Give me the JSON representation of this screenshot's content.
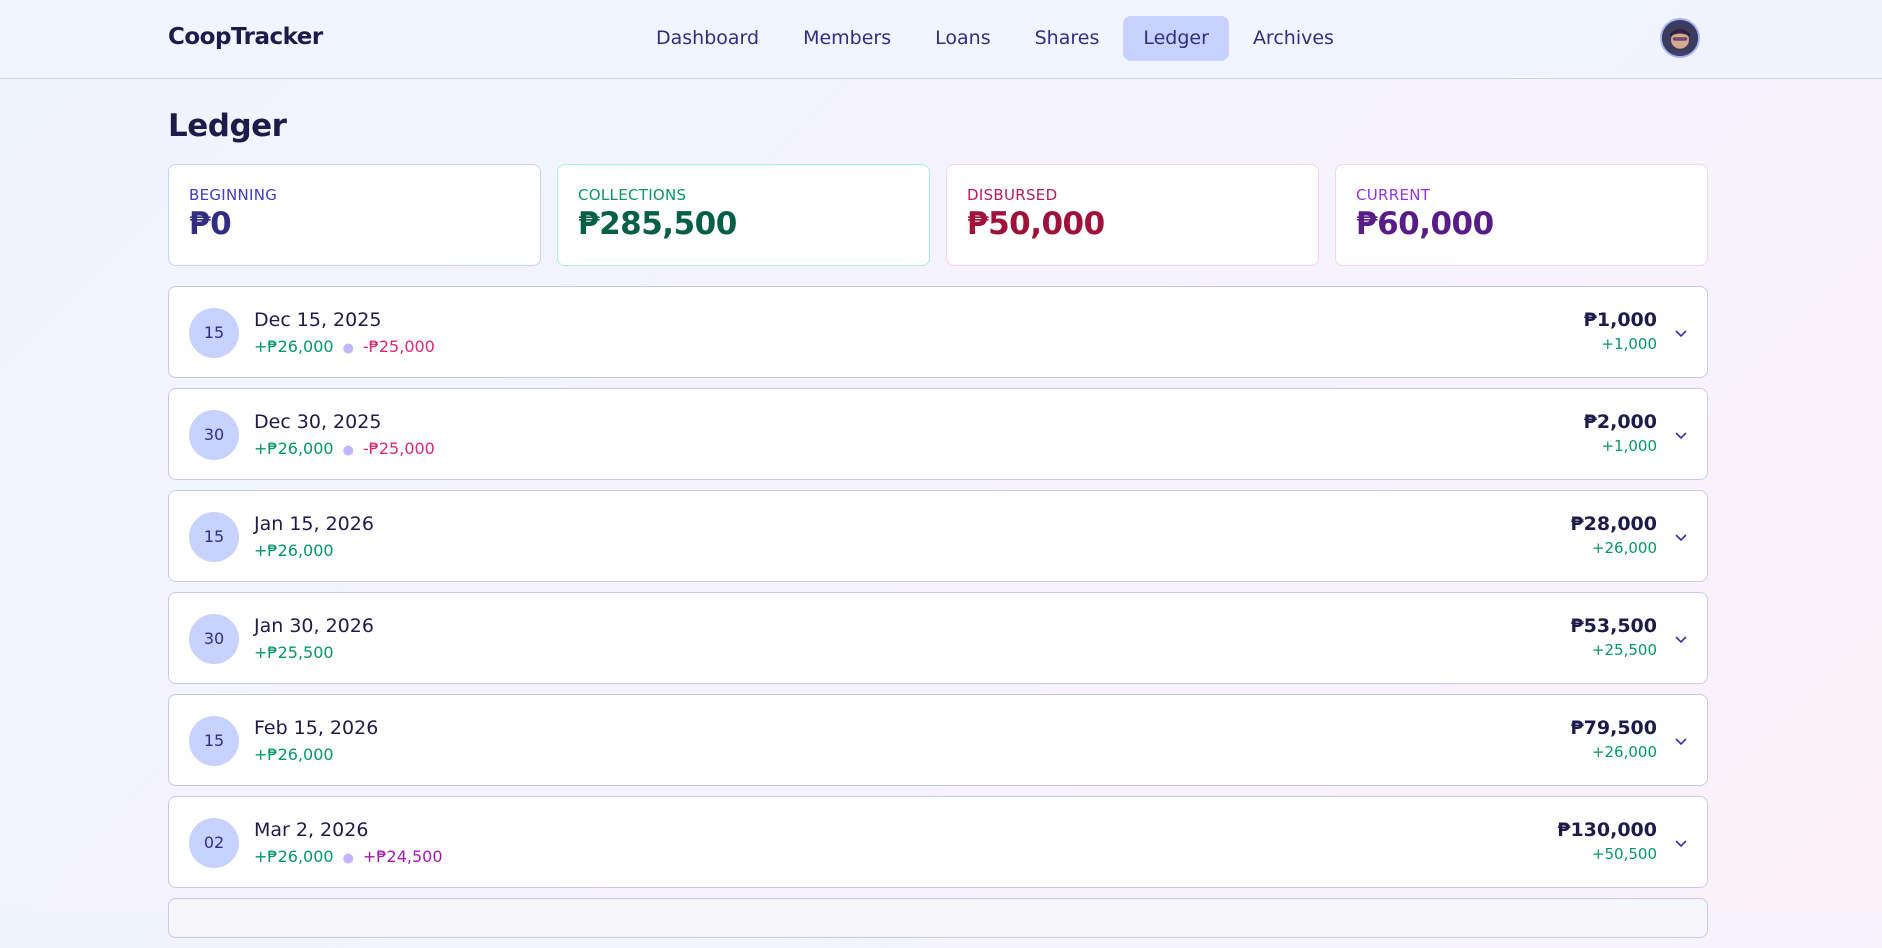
{
  "app": {
    "title": "CoopTracker"
  },
  "nav": {
    "items": [
      {
        "label": "Dashboard"
      },
      {
        "label": "Members"
      },
      {
        "label": "Loans"
      },
      {
        "label": "Shares"
      },
      {
        "label": "Ledger"
      },
      {
        "label": "Archives"
      }
    ],
    "active": "Ledger"
  },
  "page": {
    "title": "Ledger"
  },
  "stats": {
    "beginning": {
      "label": "BEGINNING",
      "value": "₱0"
    },
    "collections": {
      "label": "COLLECTIONS",
      "value": "₱285,500"
    },
    "disbursed": {
      "label": "DISBURSED",
      "value": "₱50,000"
    },
    "current": {
      "label": "CURRENT",
      "value": "₱60,000"
    }
  },
  "entries": [
    {
      "day": "15",
      "date": "Dec 15, 2025",
      "in": "+₱26,000",
      "out": "-₱25,000",
      "balance": "₱1,000",
      "change": "+1,000"
    },
    {
      "day": "30",
      "date": "Dec 30, 2025",
      "in": "+₱26,000",
      "out": "-₱25,000",
      "balance": "₱2,000",
      "change": "+1,000"
    },
    {
      "day": "15",
      "date": "Jan 15, 2026",
      "in": "+₱26,000",
      "balance": "₱28,000",
      "change": "+26,000"
    },
    {
      "day": "30",
      "date": "Jan 30, 2026",
      "in": "+₱25,500",
      "balance": "₱53,500",
      "change": "+25,500"
    },
    {
      "day": "15",
      "date": "Feb 15, 2026",
      "in": "+₱26,000",
      "balance": "₱79,500",
      "change": "+26,000"
    },
    {
      "day": "02",
      "date": "Mar 2, 2026",
      "in": "+₱26,000",
      "share": "+₱24,500",
      "balance": "₱130,000",
      "change": "+50,500"
    }
  ],
  "colors": {
    "accent": "#c7d2fe",
    "positive": "#059669",
    "negative": "#db2777",
    "share": "#a21caf"
  }
}
